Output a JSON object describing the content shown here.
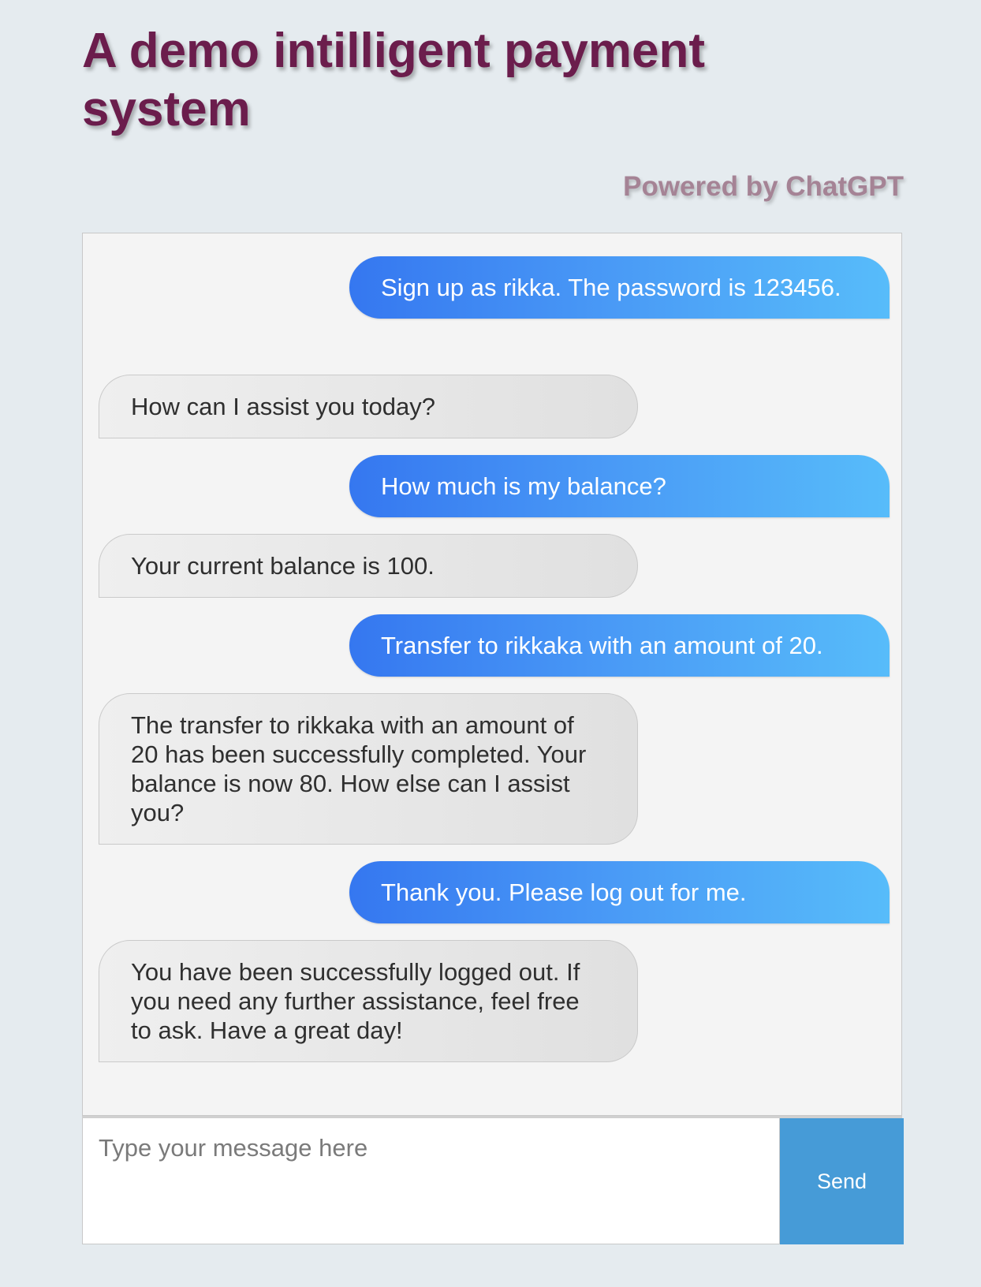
{
  "header": {
    "title": "A demo intilligent payment system",
    "powered_by": "Powered by ChatGPT"
  },
  "chat": {
    "messages": [
      {
        "role": "user",
        "text": "Sign up as rikka. The password is 123456."
      },
      {
        "role": "assistant",
        "text": "How can I assist you today?"
      },
      {
        "role": "user",
        "text": "How much is my balance?"
      },
      {
        "role": "assistant",
        "text": "Your current balance is 100."
      },
      {
        "role": "user",
        "text": "Transfer to rikkaka with an amount of 20."
      },
      {
        "role": "assistant",
        "text": "The transfer to rikkaka with an amount of 20 has been successfully completed. Your balance is now 80. How else can I assist you?"
      },
      {
        "role": "user",
        "text": "Thank you. Please log out for me."
      },
      {
        "role": "assistant",
        "text": "You have been successfully logged out. If you need any further assistance, feel free to ask. Have a great day!"
      }
    ]
  },
  "composer": {
    "placeholder": "Type your message here",
    "value": "",
    "send_label": "Send"
  },
  "colors": {
    "title": "#6b1d4c",
    "powered_by": "#a58395",
    "user_bubble_start": "#3577f0",
    "user_bubble_end": "#57bcfa",
    "bot_bubble": "#e4e4e4",
    "send_button": "#469bd7",
    "page_background": "#e5ebef"
  }
}
